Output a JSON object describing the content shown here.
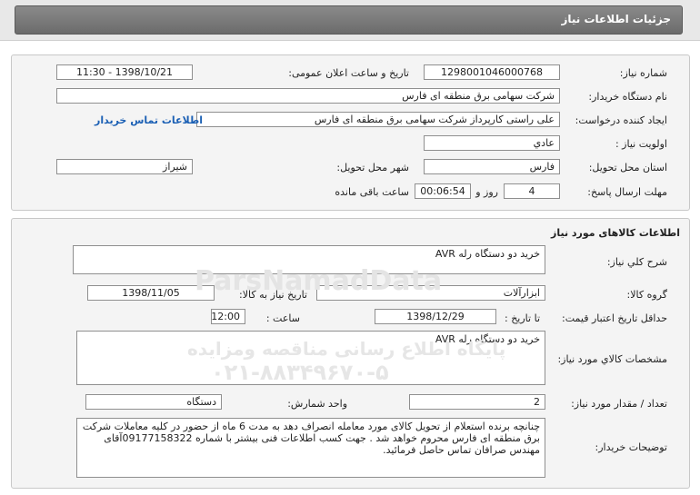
{
  "header": {
    "title": "جزئیات اطلاعات نیاز"
  },
  "need": {
    "number_label": "شماره نیاز:",
    "number": "1298001046000768",
    "announce_label": "تاریخ و ساعت اعلان عمومی:",
    "announce": "1398/10/21 - 11:30",
    "buyer_label": "نام دستگاه خریدار:",
    "buyer": "شرکت سهامی برق منطقه ای فارس",
    "creator_label": "ایجاد کننده درخواست:",
    "creator": "علی راستی کارپرداز شرکت سهامی برق منطقه ای فارس",
    "contact_link": "اطلاعات تماس خریدار",
    "priority_label": "اولویت نیاز :",
    "priority": "عادي",
    "province_label": "استان محل تحویل:",
    "province": "فارس",
    "city_label": "شهر محل تحویل:",
    "city": "شیراز",
    "deadline_label": "مهلت ارسال پاسخ:",
    "days": "4",
    "days_unit": "روز و",
    "time_left": "00:06:54",
    "time_unit": "ساعت باقی مانده"
  },
  "goods": {
    "section_title": "اطلاعات کالاهای مورد نیاز",
    "summary_label": "شرح کلي نیاز:",
    "summary": "خرید دو دستگاه  رله AVR",
    "group_label": "گروه کالا:",
    "group": "ابزارآلات",
    "need_date_label": "تاریخ نیاز به کالا:",
    "need_date": "1398/11/05",
    "validity_label": "حداقل تاریخ اعتبار قیمت:",
    "to_date_label": "تا تاریخ :",
    "to_date": "1398/12/29",
    "time_label": "ساعت :",
    "time": "12:00",
    "spec_label": "مشخصات کالاي مورد نیاز:",
    "spec": "خرید دو دستگاه  رله AVR",
    "qty_label": "تعداد / مقدار مورد نیاز:",
    "qty": "2",
    "unit_label": "واحد شمارش:",
    "unit": "دستگاه",
    "notes_label": "توضیحات خریدار:",
    "notes": "چنانچه برنده استعلام از تحویل کالای مورد معامله انصراف دهد به مدت 6 ماه از حضور در کلیه معاملات شرکت برق منطقه ای فارس محروم خواهد شد . جهت کسب اطلاعات فنی بیشتر با شماره 09177158322آقای مهندس صرافان تماس حاصل فرمائید."
  },
  "watermark": {
    "brand": "ParsNamadData",
    "line1": "پایگاه اطلاع رسانی مناقصه ومزایده",
    "line2": "۰۲۱-۸۸۳۴۹۶۷۰-۵"
  }
}
